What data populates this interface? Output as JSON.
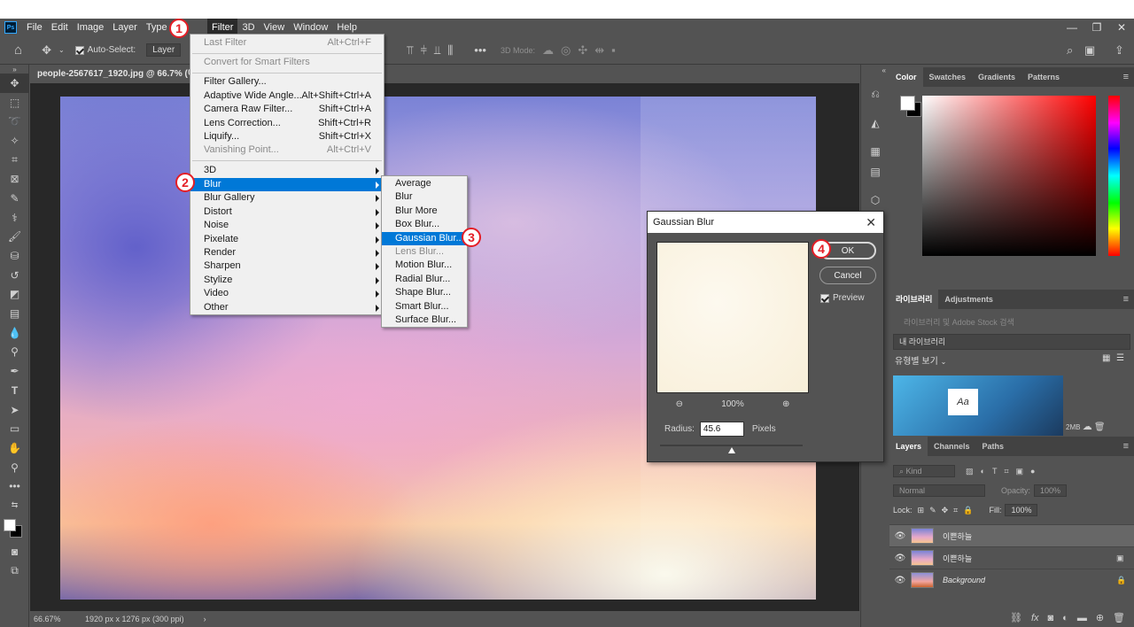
{
  "menubar": {
    "items": [
      "File",
      "Edit",
      "Image",
      "Layer",
      "Type",
      "S",
      "Filter",
      "3D",
      "View",
      "Window",
      "Help"
    ],
    "logo": "Ps"
  },
  "window_controls": [
    "—",
    "❐",
    "✕"
  ],
  "options_bar": {
    "auto_select_label": "Auto-Select:",
    "auto_select_value": "Layer",
    "mode_3d_label": "3D Mode:"
  },
  "document": {
    "tab_title": "people-2567617_1920.jpg @ 66.7% (이쁜",
    "status_zoom": "66.67%",
    "status_info": "1920 px x 1276 px (300 ppi)"
  },
  "filter_menu": {
    "items": [
      {
        "label": "Last Filter",
        "shortcut": "Alt+Ctrl+F",
        "disabled": true
      },
      {
        "label": "Convert for Smart Filters",
        "shortcut": "",
        "disabled": true
      },
      {
        "label": "Filter Gallery...",
        "shortcut": ""
      },
      {
        "label": "Adaptive Wide Angle...",
        "shortcut": "Alt+Shift+Ctrl+A"
      },
      {
        "label": "Camera Raw Filter...",
        "shortcut": "Shift+Ctrl+A"
      },
      {
        "label": "Lens Correction...",
        "shortcut": "Shift+Ctrl+R"
      },
      {
        "label": "Liquify...",
        "shortcut": "Shift+Ctrl+X"
      },
      {
        "label": "Vanishing Point...",
        "shortcut": "Alt+Ctrl+V",
        "disabled": true
      },
      {
        "label": "3D",
        "submenu": true
      },
      {
        "label": "Blur",
        "submenu": true,
        "highlighted": true
      },
      {
        "label": "Blur Gallery",
        "submenu": true
      },
      {
        "label": "Distort",
        "submenu": true
      },
      {
        "label": "Noise",
        "submenu": true
      },
      {
        "label": "Pixelate",
        "submenu": true
      },
      {
        "label": "Render",
        "submenu": true
      },
      {
        "label": "Sharpen",
        "submenu": true
      },
      {
        "label": "Stylize",
        "submenu": true
      },
      {
        "label": "Video",
        "submenu": true
      },
      {
        "label": "Other",
        "submenu": true
      }
    ]
  },
  "blur_submenu": {
    "items": [
      {
        "label": "Average"
      },
      {
        "label": "Blur"
      },
      {
        "label": "Blur More"
      },
      {
        "label": "Box Blur..."
      },
      {
        "label": "Gaussian Blur...",
        "highlighted": true
      },
      {
        "label": "Lens Blur...",
        "disabled": true
      },
      {
        "label": "Motion Blur..."
      },
      {
        "label": "Radial Blur..."
      },
      {
        "label": "Shape Blur..."
      },
      {
        "label": "Smart Blur..."
      },
      {
        "label": "Surface Blur..."
      }
    ]
  },
  "dialog": {
    "title": "Gaussian Blur",
    "ok_label": "OK",
    "cancel_label": "Cancel",
    "preview_label": "Preview",
    "zoom_value": "100%",
    "radius_label": "Radius:",
    "radius_value": "45.6",
    "radius_unit": "Pixels",
    "radius_slider_fraction": 0.5
  },
  "color_panel": {
    "tabs": [
      "Color",
      "Swatches",
      "Gradients",
      "Patterns"
    ],
    "foreground": "#ffffff",
    "background": "#000000",
    "hue_color": "#ff0000"
  },
  "library_panel": {
    "tabs": [
      "라이브러리",
      "Adjustments"
    ],
    "search_placeholder": "라이브러리 및 Adobe Stock 검색",
    "library_name": "내 라이브러리",
    "view_label": "유형별 보기",
    "thumb_text": "Aa",
    "size_label": "2MB"
  },
  "layers_panel": {
    "tabs": [
      "Layers",
      "Channels",
      "Paths"
    ],
    "kind_label": "Kind",
    "blend_mode": "Normal",
    "opacity_label": "Opacity:",
    "opacity_value": "100%",
    "lock_label": "Lock:",
    "fill_label": "Fill:",
    "fill_value": "100%",
    "layers": [
      {
        "name": "이쁜하늘",
        "selected": true,
        "italic": false
      },
      {
        "name": "이쁜하늘",
        "selected": false,
        "italic": false
      },
      {
        "name": "Background",
        "selected": false,
        "italic": true
      }
    ]
  },
  "callouts": [
    "1",
    "2",
    "3",
    "4"
  ],
  "accent_color": "#0078d7",
  "callout_color": "#e41e26"
}
